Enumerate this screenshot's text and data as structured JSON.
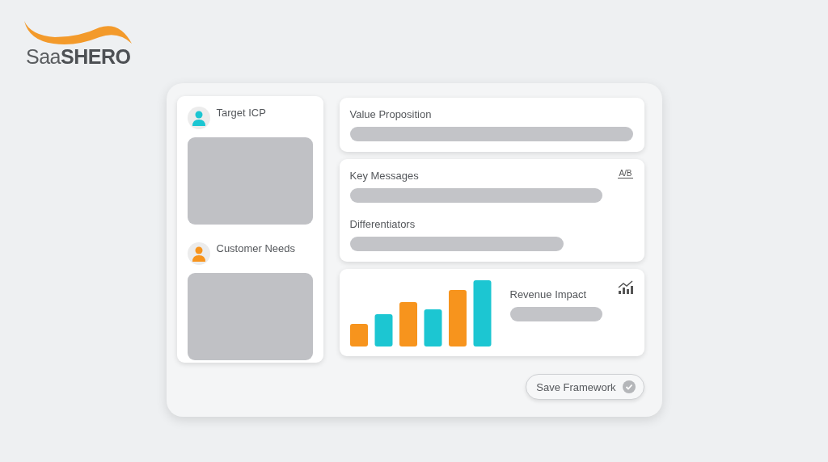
{
  "logo": {
    "text": "Saa**SHERO**"
  },
  "left_card": {
    "sections": [
      {
        "title": "Target ICP",
        "color": "#1cc6d2"
      },
      {
        "title": "Customer Needs",
        "color": "#f7941d"
      }
    ]
  },
  "cards": [
    {
      "kind": "text",
      "sections": [
        {
          "title": "Value Proposition"
        }
      ]
    },
    {
      "kind": "text",
      "icon_text": "A/B",
      "sections": [
        {
          "title": "Key Messages"
        },
        {
          "title": "Differentiators"
        }
      ]
    },
    {
      "kind": "chart",
      "sections": [
        {
          "title": "Revenue Impact"
        }
      ]
    }
  ],
  "save_button": {
    "label": "Save Framework"
  }
}
